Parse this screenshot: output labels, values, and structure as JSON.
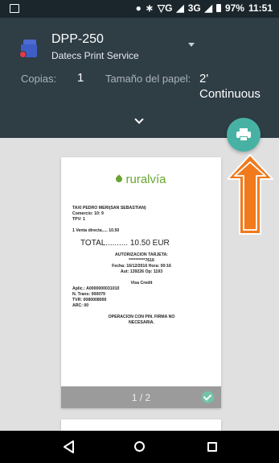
{
  "status_bar": {
    "icons": [
      "notification-icon",
      "location-icon",
      "bluetooth-icon",
      "wifi-icon",
      "signal-icon",
      "signal-3g-icon",
      "battery-icon"
    ],
    "wifi_text": "G",
    "network": "3G",
    "battery": "97%",
    "time": "11:51"
  },
  "printer": {
    "name": "DPP-250",
    "service": "Datecs Print Service",
    "copies_label": "Copias:",
    "copies_value": "1",
    "paper_label": "Tamaño del papel:",
    "paper_value": "2' Continuous"
  },
  "preview": {
    "logo": "ruralvía",
    "receipt": {
      "header": [
        "TAXI PEDRO MERI(SAN SEBASTIAN)",
        "Comercio: 10:       9",
        "TPV: 1"
      ],
      "sale": "1 Venta directa.....   10.50",
      "total": "TOTAL.......... 10.50 EUR",
      "auth": [
        "AUTORIZACION TARJETA:",
        "**********7616",
        "Fecha: 16/12/2016  Hora: 00:16",
        "Aut: 139226          Op: 1193"
      ],
      "card": [
        "Visa Credit",
        "Aplic.: A0000000031010",
        "N. Trans: 000079",
        "TVR: 0080008000",
        "ARC: 00"
      ],
      "footer": [
        "OPERACION CON PIN. FIRMA NO",
        "NECESARIA."
      ]
    },
    "page_number": "1 / 2",
    "page_selected": true
  },
  "colors": {
    "header_bg": "#2f3d45",
    "status_bar_bg": "#1b262c",
    "fab": "#47b2a4",
    "arrow": "#f07a1c",
    "logo_green": "#6aa630",
    "page_footer": "#9b9b9b"
  },
  "nav_bar": {
    "icons": [
      "back-icon",
      "home-icon",
      "recent-apps-icon"
    ]
  }
}
